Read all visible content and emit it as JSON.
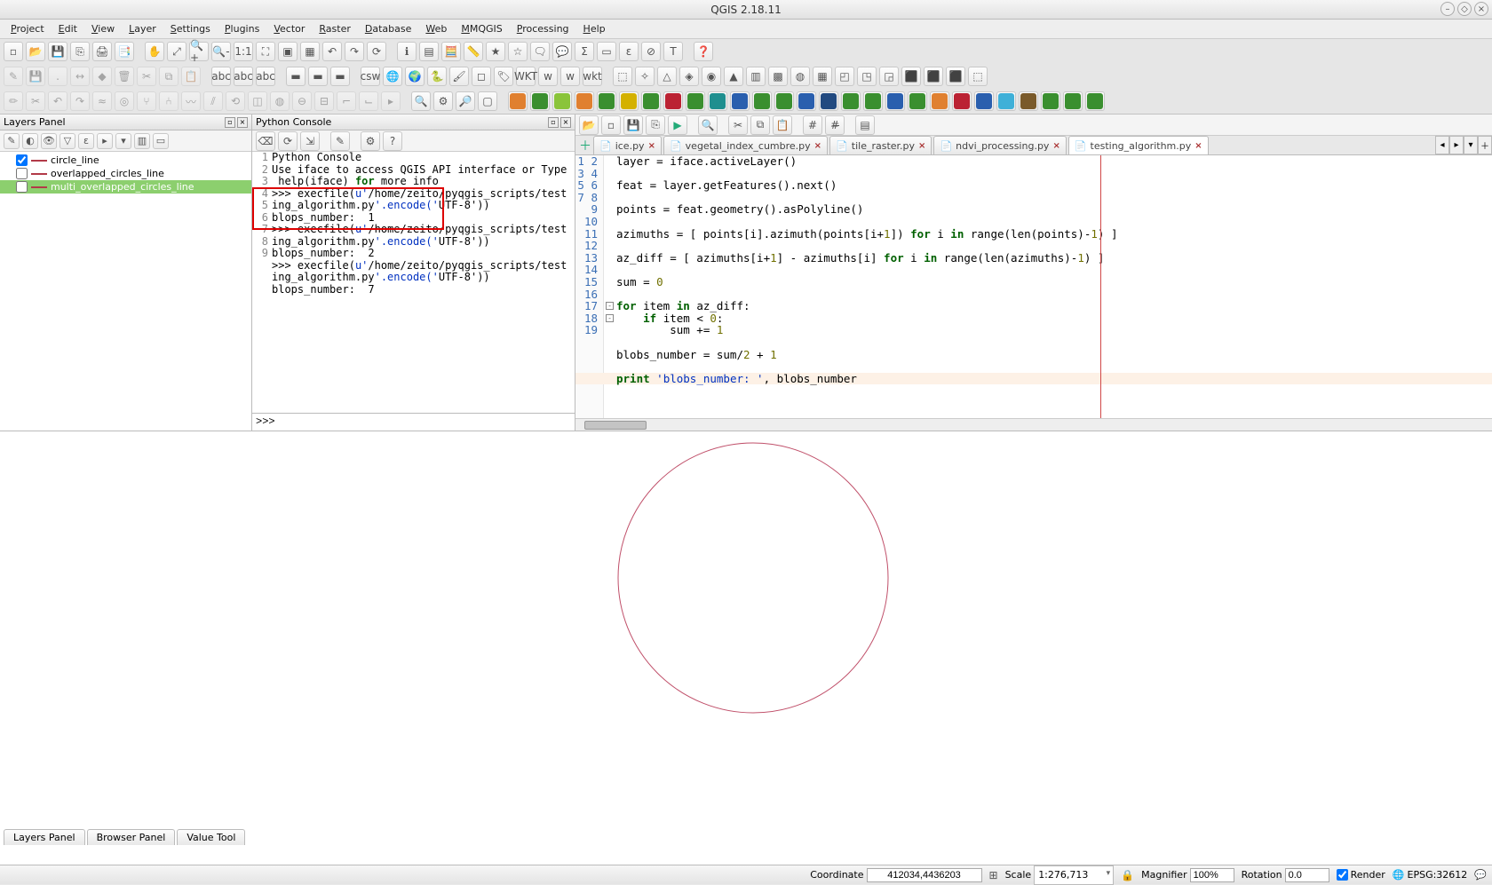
{
  "window": {
    "title": "QGIS 2.18.11"
  },
  "menus": [
    "Project",
    "Edit",
    "View",
    "Layer",
    "Settings",
    "Plugins",
    "Vector",
    "Raster",
    "Database",
    "Web",
    "MMQGIS",
    "Processing",
    "Help"
  ],
  "toolbar_row1": [
    {
      "n": "new-project-icon",
      "g": "▫"
    },
    {
      "n": "open-project-icon",
      "g": "📂"
    },
    {
      "n": "save-project-icon",
      "g": "💾"
    },
    {
      "n": "save-as-icon",
      "g": "⎘"
    },
    {
      "n": "composer-icon",
      "g": "🖨"
    },
    {
      "n": "composer-manager-icon",
      "g": "📑",
      "sep": true
    },
    {
      "n": "pan-icon",
      "g": "✋"
    },
    {
      "n": "pan-selection-icon",
      "g": "⤢"
    },
    {
      "n": "zoom-in-icon",
      "g": "🔍+"
    },
    {
      "n": "zoom-out-icon",
      "g": "🔍-"
    },
    {
      "n": "zoom-native-icon",
      "g": "1:1"
    },
    {
      "n": "zoom-full-icon",
      "g": "⛶"
    },
    {
      "n": "zoom-selection-icon",
      "g": "▣"
    },
    {
      "n": "zoom-layer-icon",
      "g": "▦"
    },
    {
      "n": "zoom-last-icon",
      "g": "↶"
    },
    {
      "n": "zoom-next-icon",
      "g": "↷"
    },
    {
      "n": "refresh-icon",
      "g": "⟳",
      "sep": true
    },
    {
      "n": "identify-icon",
      "g": "ℹ"
    },
    {
      "n": "open-table-icon",
      "g": "▤"
    },
    {
      "n": "field-calc-icon",
      "g": "🧮"
    },
    {
      "n": "measure-icon",
      "g": "📏"
    },
    {
      "n": "bookmarks-icon",
      "g": "★"
    },
    {
      "n": "new-bookmark-icon",
      "g": "☆"
    },
    {
      "n": "annotation-icon",
      "g": "🗨"
    },
    {
      "n": "map-tips-icon",
      "g": "💬"
    },
    {
      "n": "statistics-icon",
      "g": "Σ"
    },
    {
      "n": "select-icon",
      "g": "▭"
    },
    {
      "n": "select-expr-icon",
      "g": "ε"
    },
    {
      "n": "deselect-icon",
      "g": "⊘"
    },
    {
      "n": "text-annotation-icon",
      "g": "T",
      "sep": true
    },
    {
      "n": "help-icon",
      "g": "❓",
      "sep": true
    }
  ],
  "toolbar_row2": [
    {
      "n": "toggle-edit-icon",
      "g": "✎",
      "dim": true
    },
    {
      "n": "save-edits-icon",
      "g": "💾",
      "dim": true
    },
    {
      "n": "add-feature-icon",
      "g": ".",
      "dim": true
    },
    {
      "n": "move-feature-icon",
      "g": "↔",
      "dim": true
    },
    {
      "n": "node-tool-icon",
      "g": "◆",
      "dim": true
    },
    {
      "n": "delete-icon",
      "g": "🗑",
      "dim": true
    },
    {
      "n": "cut-icon",
      "g": "✂",
      "dim": true
    },
    {
      "n": "copy-icon",
      "g": "⧉",
      "dim": true
    },
    {
      "n": "paste-icon",
      "g": "📋",
      "dim": true,
      "sep": true
    },
    {
      "n": "abc-box-icon",
      "g": "abc"
    },
    {
      "n": "abc-yellow-icon",
      "g": "abc"
    },
    {
      "n": "abc-line-icon",
      "g": "abc",
      "sep": true
    },
    {
      "n": "color-swatch-1-icon",
      "g": "▬"
    },
    {
      "n": "color-swatch-2-icon",
      "g": "▬"
    },
    {
      "n": "color-swatch-3-icon",
      "g": "▬",
      "sep": true
    },
    {
      "n": "csw-icon",
      "g": "csw"
    },
    {
      "n": "metasearch-icon",
      "g": "🌐"
    },
    {
      "n": "osm-icon",
      "g": "🌍"
    },
    {
      "n": "python-icon",
      "g": "🐍"
    },
    {
      "n": "brush-icon",
      "g": "🖌"
    },
    {
      "n": "extent-icon",
      "g": "◻"
    },
    {
      "n": "labels-icon",
      "g": "🏷"
    },
    {
      "n": "wkt-wkt-icon",
      "g": "WKT"
    },
    {
      "n": "wkt1-icon",
      "g": "w"
    },
    {
      "n": "wkt2-icon",
      "g": "w"
    },
    {
      "n": "wkt-badge-icon",
      "g": "wkt",
      "sep": true
    },
    {
      "n": "plugin-1-icon",
      "g": "⬚"
    },
    {
      "n": "plugin-2-icon",
      "g": "✧"
    },
    {
      "n": "plugin-3-icon",
      "g": "△"
    },
    {
      "n": "plugin-4-icon",
      "g": "◈"
    },
    {
      "n": "plugin-5-icon",
      "g": "◉"
    },
    {
      "n": "plugin-6-icon",
      "g": "▲"
    },
    {
      "n": "plugin-7-icon",
      "g": "▥"
    },
    {
      "n": "plugin-8-icon",
      "g": "▩"
    },
    {
      "n": "plugin-9-icon",
      "g": "◍"
    },
    {
      "n": "plugin-10-icon",
      "g": "▦"
    },
    {
      "n": "plugin-11-icon",
      "g": "◰"
    },
    {
      "n": "plugin-12-icon",
      "g": "◳"
    },
    {
      "n": "plugin-13-icon",
      "g": "◲"
    },
    {
      "n": "plugin-14-icon",
      "g": "⬛"
    },
    {
      "n": "plugin-15-icon",
      "g": "⬛"
    },
    {
      "n": "plugin-render-icon",
      "g": "⬛"
    },
    {
      "n": "plugin-extra-icon",
      "g": "⬚"
    }
  ],
  "toolbar_row3": [
    {
      "n": "edit-pencil-icon",
      "g": "✏",
      "dim": true
    },
    {
      "n": "edit-scissors-icon",
      "g": "✂",
      "dim": true
    },
    {
      "n": "undo-icon",
      "g": "↶",
      "dim": true
    },
    {
      "n": "redo-icon",
      "g": "↷",
      "dim": true
    },
    {
      "n": "simplify-icon",
      "g": "≈",
      "dim": true
    },
    {
      "n": "ring-icon",
      "g": "◎",
      "dim": true
    },
    {
      "n": "split-icon",
      "g": "⑂",
      "dim": true
    },
    {
      "n": "merge-icon",
      "g": "⑃",
      "dim": true
    },
    {
      "n": "reshape-icon",
      "g": "〰",
      "dim": true
    },
    {
      "n": "offset-icon",
      "g": "⫽",
      "dim": true
    },
    {
      "n": "rotate-icon",
      "g": "⟲",
      "dim": true
    },
    {
      "n": "part-icon",
      "g": "◫",
      "dim": true
    },
    {
      "n": "fill-ring-icon",
      "g": "◍",
      "dim": true
    },
    {
      "n": "delete-ring-icon",
      "g": "⊖",
      "dim": true
    },
    {
      "n": "delete-part-icon",
      "g": "⊟",
      "dim": true
    },
    {
      "n": "trim-icon",
      "g": "⌐",
      "dim": true
    },
    {
      "n": "extend-icon",
      "g": "⌙",
      "dim": true
    },
    {
      "n": "arrow-icon",
      "g": "▸",
      "dim": true,
      "sep": true
    },
    {
      "n": "row3-zoom-icon",
      "g": "🔍"
    },
    {
      "n": "row3-gear-icon",
      "g": "⚙"
    },
    {
      "n": "row3-find-icon",
      "g": "🔎"
    },
    {
      "n": "row3-box-icon",
      "g": "▢",
      "sep": true
    }
  ],
  "plugin_row": [
    {
      "c": "c-orange"
    },
    {
      "c": "c-green"
    },
    {
      "c": "c-lime"
    },
    {
      "c": "c-orange"
    },
    {
      "c": "c-green"
    },
    {
      "c": "c-yellow"
    },
    {
      "c": "c-green"
    },
    {
      "c": "c-red"
    },
    {
      "c": "c-green"
    },
    {
      "c": "c-teal"
    },
    {
      "c": "c-blue"
    },
    {
      "c": "c-green"
    },
    {
      "c": "c-green"
    },
    {
      "c": "c-blue"
    },
    {
      "c": "c-navy"
    },
    {
      "c": "c-green"
    },
    {
      "c": "c-green"
    },
    {
      "c": "c-blue"
    },
    {
      "c": "c-green"
    },
    {
      "c": "c-orange"
    },
    {
      "c": "c-red"
    },
    {
      "c": "c-blue"
    },
    {
      "c": "c-cyan"
    },
    {
      "c": "c-brown"
    },
    {
      "c": "c-green"
    },
    {
      "c": "c-green"
    },
    {
      "c": "c-green"
    }
  ],
  "layers_panel": {
    "title": "Layers Panel",
    "items": [
      {
        "checked": true,
        "color": "#b23a48",
        "name": "circle_line"
      },
      {
        "checked": false,
        "color": "#b23a48",
        "name": "overlapped_circles_line"
      },
      {
        "checked": false,
        "color": "#b23a48",
        "name": "multi_overlapped_circles_line",
        "selected": true
      }
    ]
  },
  "python_console": {
    "title": "Python Console",
    "prompt": ">>>",
    "lines": [
      {
        "n": 1,
        "t": "Python Console"
      },
      {
        "n": 2,
        "t": "Use iface to access QGIS API interface or Type help(iface) for more info"
      },
      {
        "n": 3,
        "t": ">>> execfile(u'/home/zeito/pyqgis_scripts/testing_algorithm.py'.encode('UTF-8'))"
      },
      {
        "n": 4,
        "t": "blops_number:  1"
      },
      {
        "n": 5,
        "t": ">>> execfile(u'/home/zeito/pyqgis_scripts/testing_algorithm.py'.encode('UTF-8'))"
      },
      {
        "n": 6,
        "t": "blops_number:  2"
      },
      {
        "n": 7,
        "t": ">>> execfile(u'/home/zeito/pyqgis_scripts/testing_algorithm.py'.encode('UTF-8'))"
      },
      {
        "n": 8,
        "t": "blops_number:  7"
      },
      {
        "n": 9,
        "t": ""
      }
    ]
  },
  "editor": {
    "tabs": [
      {
        "label": "ice.py",
        "truncated": true
      },
      {
        "label": "vegetal_index_cumbre.py"
      },
      {
        "label": "tile_raster.py"
      },
      {
        "label": "ndvi_processing.py"
      },
      {
        "label": "testing_algorithm.py",
        "active": true
      }
    ],
    "code": [
      "layer = iface.activeLayer()",
      "",
      "feat = layer.getFeatures().next()",
      "",
      "points = feat.geometry().asPolyline()",
      "",
      "azimuths = [ points[i].azimuth(points[i+1]) for i in range(len(points)-1) ]",
      "",
      "az_diff = [ azimuths[i+1] - azimuths[i] for i in range(len(azimuths)-1) ]",
      "",
      "sum = 0",
      "",
      "for item in az_diff:",
      "    if item < 0:",
      "        sum += 1",
      "",
      "blobs_number = sum/2 + 1",
      "",
      "print 'blobs_number: ', blobs_number"
    ]
  },
  "bottom_tabs": [
    "Layers Panel",
    "Browser Panel",
    "Value Tool"
  ],
  "status": {
    "coord_label": "Coordinate",
    "coord": "412034,4436203",
    "scale_label": "Scale",
    "scale": "1:276,713",
    "mag_label": "Magnifier",
    "mag": "100%",
    "rot_label": "Rotation",
    "rot": "0.0",
    "render_label": "Render",
    "render_checked": true,
    "epsg_label": "EPSG:32612"
  }
}
